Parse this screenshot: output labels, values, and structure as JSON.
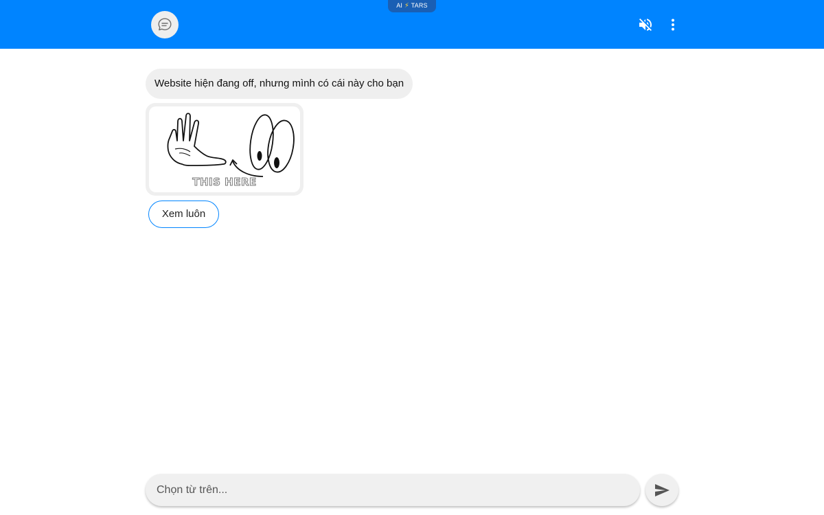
{
  "header": {
    "brand_prefix": "AI",
    "brand_bolt": "⚡",
    "brand_name": "TARS",
    "background_color": "#0084ff",
    "avatar_icon": "chat-bubble-icon",
    "mute_icon": "volume-off-icon",
    "menu_icon": "more-vert-icon"
  },
  "messages": [
    {
      "type": "text",
      "text": "Website hiện đang off, nhưng mình có cái này cho bạn"
    },
    {
      "type": "image",
      "caption_in_image": "THIS HERE",
      "image_description_icon": "hand-and-eyes-illustration"
    }
  ],
  "quick_replies": [
    {
      "label": "Xem luôn"
    }
  ],
  "composer": {
    "placeholder": "Chọn từ trên...",
    "value": "",
    "send_icon": "send-icon"
  }
}
